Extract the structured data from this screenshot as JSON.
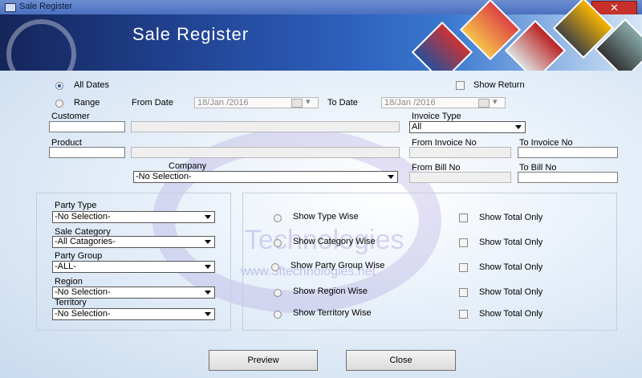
{
  "window": {
    "title": "Sale Register",
    "close_glyph": "✕"
  },
  "banner": {
    "heading": "Sale Register"
  },
  "watermark": {
    "text": "Technologies",
    "url": "www.3ftechnologies.net"
  },
  "date_options": {
    "all_dates": "All Dates",
    "range": "Range",
    "selected": "all_dates"
  },
  "show_return": "Show Return",
  "from_date": {
    "label": "From Date",
    "value": "18/Jan /2016"
  },
  "to_date": {
    "label": "To Date",
    "value": "18/Jan /2016"
  },
  "customer": {
    "label": "Customer",
    "code": "",
    "name": ""
  },
  "product": {
    "label": "Product",
    "code": "",
    "name": ""
  },
  "invoice_type": {
    "label": "Invoice Type",
    "value": "All"
  },
  "from_invoice_no": {
    "label": "From Invoice No",
    "value": ""
  },
  "to_invoice_no": {
    "label": "To Invoice No",
    "value": ""
  },
  "company": {
    "label": "Company",
    "value": "-No Selection-"
  },
  "from_bill_no": {
    "label": "From Bill  No",
    "value": ""
  },
  "to_bill_no": {
    "label": "To Bill No",
    "value": ""
  },
  "filters": {
    "party_type": {
      "label": "Party Type",
      "value": "-No Selection-"
    },
    "sale_category": {
      "label": "Sale Category",
      "value": "-All Catagories-"
    },
    "party_group": {
      "label": "Party Group",
      "value": "-ALL-"
    },
    "region": {
      "label": "Region",
      "value": "-No Selection-"
    },
    "territory": {
      "label": "Territory",
      "value": "-No Selection-"
    }
  },
  "report_options": [
    {
      "label": "Show Type Wise",
      "total_label": "Show Total Only"
    },
    {
      "label": "Show Category Wise",
      "total_label": "Show Total Only"
    },
    {
      "label": "Show Party Group Wise",
      "total_label": "Show Total Only"
    },
    {
      "label": "Show Region Wise",
      "total_label": "Show Total Only"
    },
    {
      "label": "Show Territory Wise",
      "total_label": "Show Total Only"
    }
  ],
  "buttons": {
    "preview": "Preview",
    "close": "Close"
  }
}
